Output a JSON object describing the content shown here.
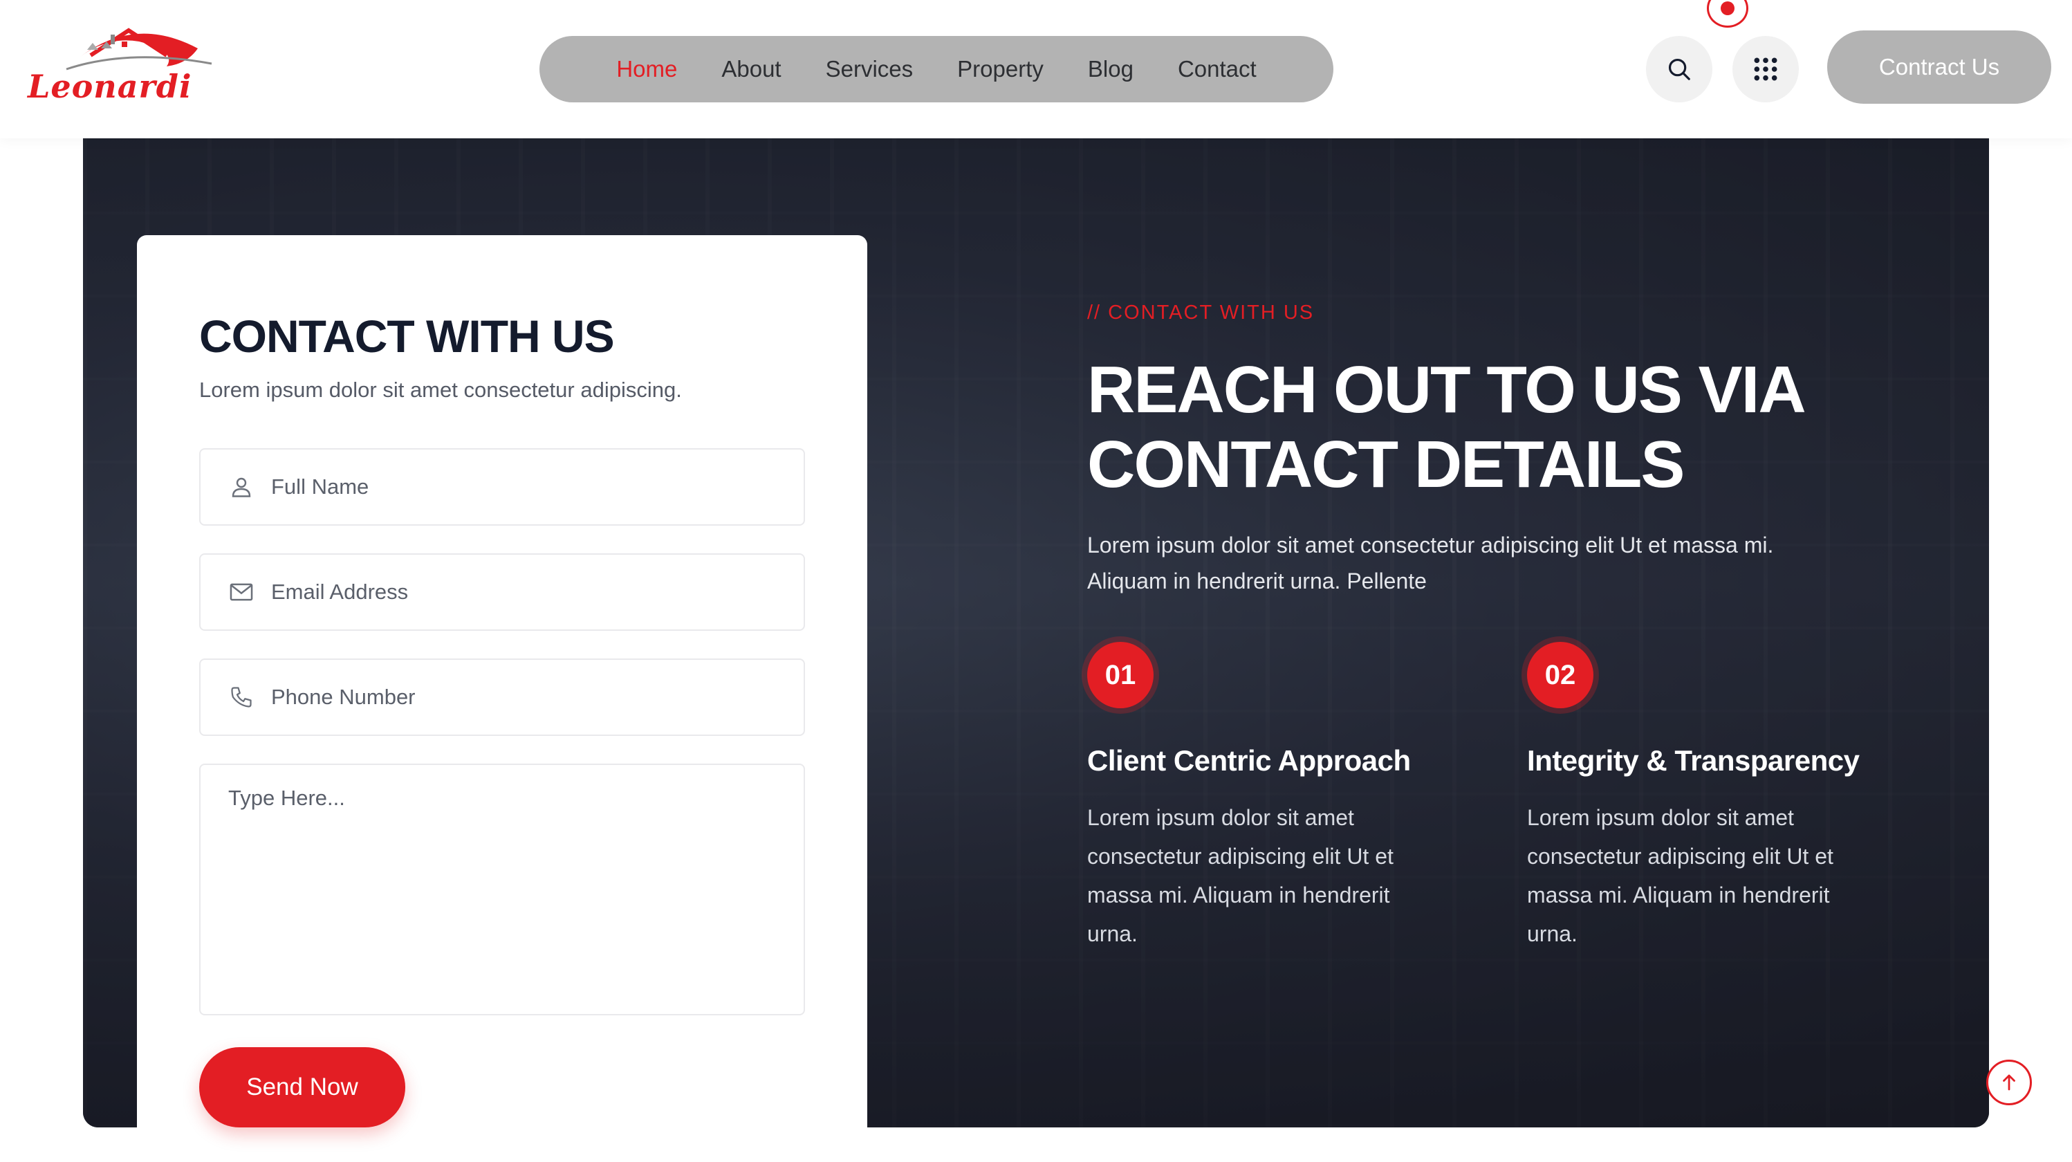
{
  "header": {
    "logo_text": "Leonardi",
    "nav": [
      {
        "label": "Home",
        "active": true
      },
      {
        "label": "About"
      },
      {
        "label": "Services"
      },
      {
        "label": "Property"
      },
      {
        "label": "Blog"
      },
      {
        "label": "Contact"
      }
    ],
    "icons": [
      "search-icon",
      "grid-menu-icon"
    ],
    "cta_label": "Contract Us"
  },
  "form": {
    "title": "CONTACT WITH US",
    "subtitle": "Lorem ipsum dolor sit amet consectetur adipiscing.",
    "fields": {
      "name_placeholder": "Full Name",
      "email_placeholder": "Email Address",
      "phone_placeholder": "Phone Number",
      "message_placeholder": "Type Here..."
    },
    "submit_label": "Send Now"
  },
  "info": {
    "eyebrow": "//  CONTACT WITH US",
    "headline_line1": "REACH OUT TO US VIA",
    "headline_line2": "CONTACT DETAILS",
    "lead": "Lorem ipsum dolor sit amet consectetur adipiscing elit Ut et massa mi. Aliquam in hendrerit urna. Pellente",
    "features": [
      {
        "number": "01",
        "title": "Client Centric Approach",
        "text": "Lorem ipsum dolor sit amet consectetur adipiscing elit Ut et massa mi. Aliquam in hendrerit urna."
      },
      {
        "number": "02",
        "title": "Integrity & Transparency",
        "text": "Lorem ipsum dolor sit amet consectetur adipiscing elit Ut et massa mi. Aliquam in hendrerit urna."
      }
    ]
  },
  "colors": {
    "accent": "#e31e24",
    "dark": "#141b2d",
    "nav_bg": "#b3b3b3"
  }
}
